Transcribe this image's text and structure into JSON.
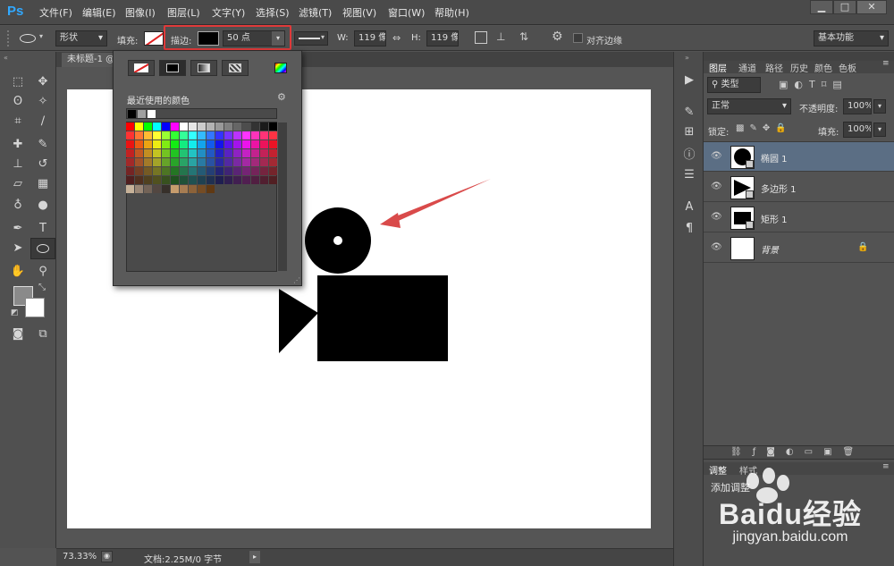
{
  "app": {
    "logo": "Ps"
  },
  "menu": [
    "文件(F)",
    "编辑(E)",
    "图像(I)",
    "图层(L)",
    "文字(Y)",
    "选择(S)",
    "滤镜(T)",
    "视图(V)",
    "窗口(W)",
    "帮助(H)"
  ],
  "window_controls": {
    "minimize": "▁",
    "maximize": "□",
    "close": "✕"
  },
  "options": {
    "mode": "形状",
    "fill_label": "填充:",
    "stroke_label": "描边:",
    "stroke_size": "50 点",
    "w_label": "W:",
    "w_value": "119 像:",
    "h_label": "H:",
    "h_value": "119 像:",
    "align_edges": "对齐边缘",
    "workspace": "基本功能"
  },
  "document": {
    "tab": "未标题-1 @"
  },
  "popup": {
    "recent_label": "最近使用的颜色",
    "recent_colors": [
      "#000000",
      "#a0a0a0",
      "#ffffff"
    ],
    "spectrum_icon": "spectrum-icon",
    "gear_icon": "gear-icon"
  },
  "layers_panel": {
    "tabs": [
      "图层",
      "通道",
      "路径",
      "历史",
      "颜色",
      "色板"
    ],
    "kind_filter": "类型",
    "blend_mode": "正常",
    "opacity_label": "不透明度:",
    "opacity_value": "100%",
    "lock_label": "锁定:",
    "fill_label": "填充:",
    "fill_value": "100%",
    "layers": [
      {
        "name": "椭圆 1",
        "selected": true
      },
      {
        "name": "多边形 1",
        "selected": false
      },
      {
        "name": "矩形 1",
        "selected": false
      },
      {
        "name": "背景",
        "selected": false,
        "locked": true
      }
    ]
  },
  "adjust_panel": {
    "tabs": [
      "调整",
      "样式"
    ],
    "title": "添加调整"
  },
  "status": {
    "zoom": "73.33%",
    "doc_info": "文档:2.25M/0 字节"
  },
  "watermark": {
    "brand": "Baidu经验",
    "url": "jingyan.baidu.com"
  },
  "colors": {
    "highlight": "#e03a3a",
    "arrow": "#d94a4a",
    "selected_layer": "#5b6e84"
  }
}
